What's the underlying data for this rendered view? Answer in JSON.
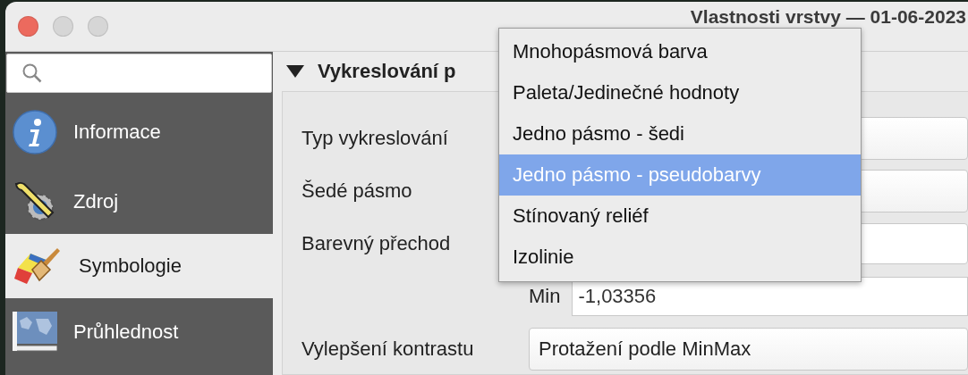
{
  "window": {
    "title": "Vlastnosti vrstvy — 01-06-2023"
  },
  "sidebar": {
    "items": [
      {
        "label": "Informace",
        "kind": "info",
        "selected": false
      },
      {
        "label": "Zdroj",
        "kind": "tools",
        "selected": false
      },
      {
        "label": "Symbologie",
        "kind": "brush",
        "selected": true
      },
      {
        "label": "Průhlednost",
        "kind": "map",
        "selected": false
      }
    ]
  },
  "section": {
    "title": "Vykreslování p",
    "expanded": true
  },
  "form": {
    "rows": [
      {
        "label": "Typ vykreslování",
        "kind": "combo"
      },
      {
        "label": "Šedé pásmo",
        "kind": "combo"
      },
      {
        "label": "Barevný přechod",
        "kind": "ramp"
      },
      {
        "label": "Min",
        "kind": "field",
        "value": "-1,03356"
      },
      {
        "label": "Vylepšení kontrastu",
        "kind": "combo",
        "value": "Protažení podle MinMax"
      }
    ]
  },
  "dropdown_menu": {
    "items": [
      {
        "label": "Mnohopásmová barva",
        "selected": false
      },
      {
        "label": "Paleta/Jedinečné hodnoty",
        "selected": false
      },
      {
        "label": "Jedno pásmo - šedi",
        "selected": false
      },
      {
        "label": "Jedno pásmo - pseudobarvy",
        "selected": true
      },
      {
        "label": "Stínovaný reliéf",
        "selected": false
      },
      {
        "label": "Izolinie",
        "selected": false
      }
    ]
  }
}
